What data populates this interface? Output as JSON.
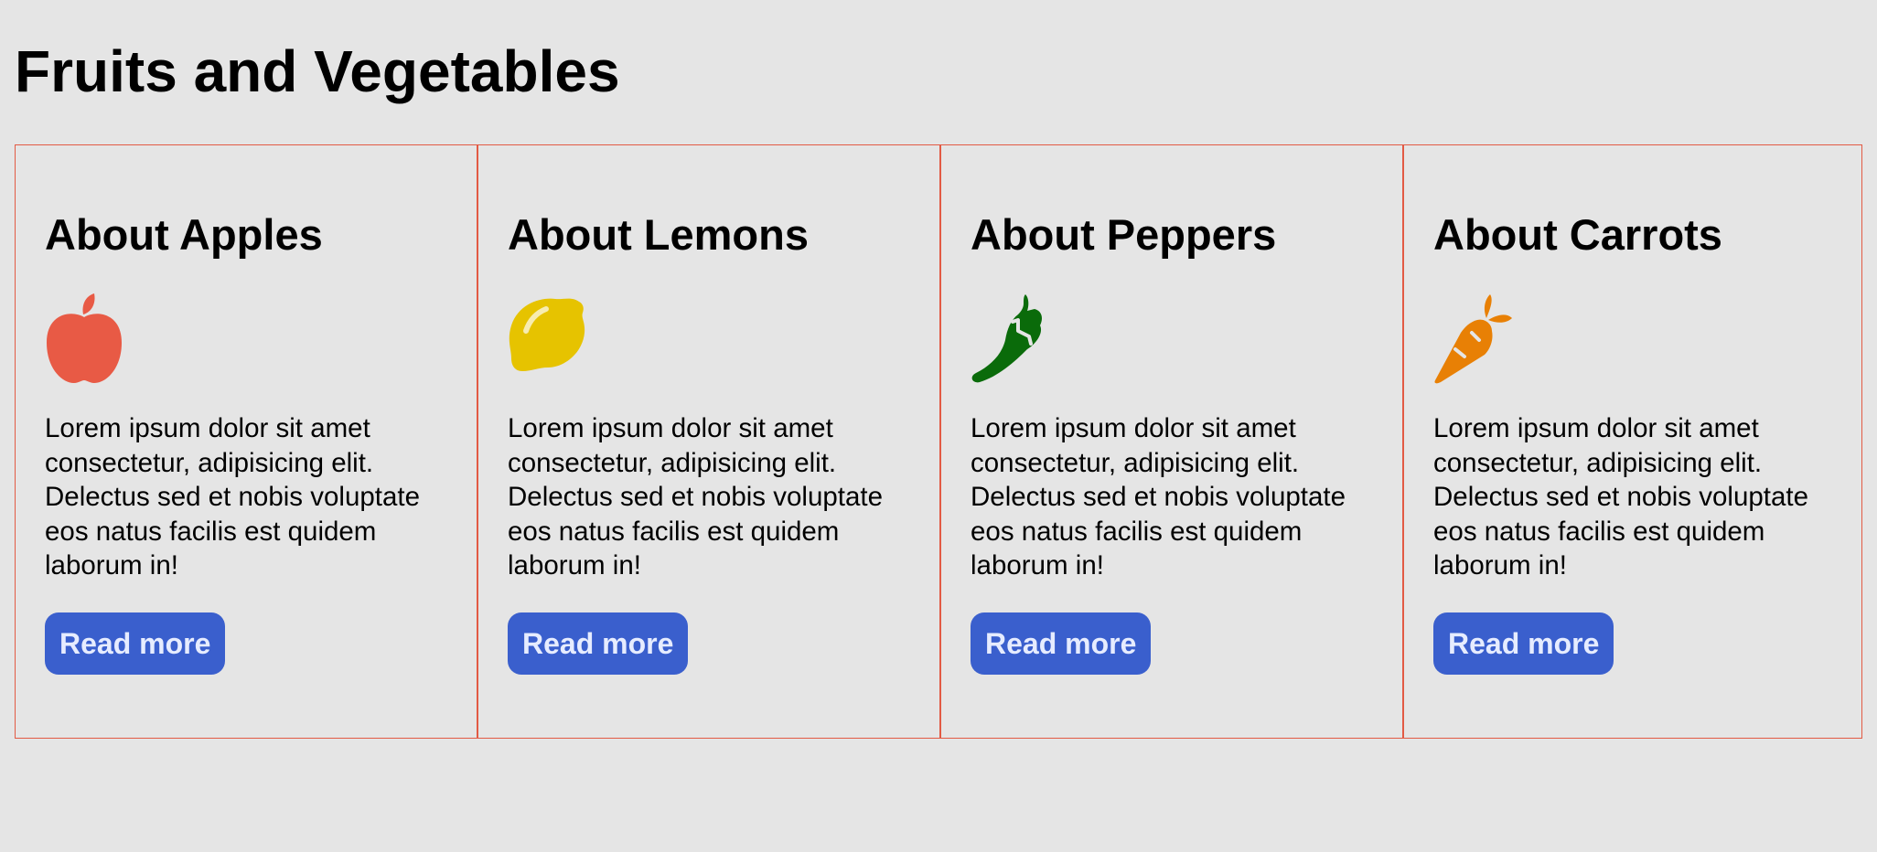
{
  "page": {
    "title": "Fruits and Vegetables"
  },
  "colors": {
    "background": "#e5e5e5",
    "border": "#e25a44",
    "button": "#3a5fcd",
    "button_text": "#e6ecff"
  },
  "cards": [
    {
      "title": "About Apples",
      "icon": "apple-icon",
      "icon_color": "#e85a45",
      "text": "Lorem ipsum dolor sit amet consectetur, adipisicing elit. Delectus sed et nobis voluptate eos natus facilis est quidem laborum in!",
      "button_label": "Read more"
    },
    {
      "title": "About Lemons",
      "icon": "lemon-icon",
      "icon_color": "#e6c300",
      "text": "Lorem ipsum dolor sit amet consectetur, adipisicing elit. Delectus sed et nobis voluptate eos natus facilis est quidem laborum in!",
      "button_label": "Read more"
    },
    {
      "title": "About Peppers",
      "icon": "pepper-icon",
      "icon_color": "#0a6b0a",
      "text": "Lorem ipsum dolor sit amet consectetur, adipisicing elit. Delectus sed et nobis voluptate eos natus facilis est quidem laborum in!",
      "button_label": "Read more"
    },
    {
      "title": "About Carrots",
      "icon": "carrot-icon",
      "icon_color": "#e88005",
      "text": "Lorem ipsum dolor sit amet consectetur, adipisicing elit. Delectus sed et nobis voluptate eos natus facilis est quidem laborum in!",
      "button_label": "Read more"
    }
  ]
}
